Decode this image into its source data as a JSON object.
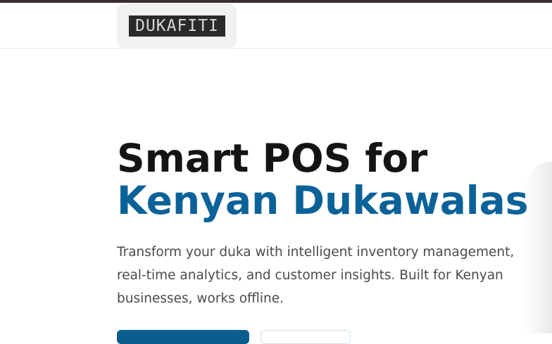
{
  "header": {
    "logo_text": "DUKAFITI"
  },
  "hero": {
    "title_line1": "Smart POS for",
    "title_line2": "Kenyan Dukawalas",
    "description": "Transform your duka with intelligent inventory management, real-time analytics, and customer insights. Built for Kenyan businesses, works offline."
  },
  "colors": {
    "accent": "#0b6298",
    "title": "#141414",
    "top_border": "#3b2a2e"
  }
}
